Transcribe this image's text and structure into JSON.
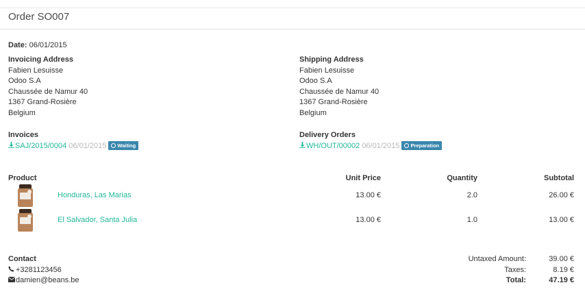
{
  "order": {
    "title": "Order SO007"
  },
  "date": {
    "label": "Date:",
    "value": "06/01/2015"
  },
  "invoicing": {
    "title": "Invoicing Address",
    "lines": [
      "Fabien Lesuisse",
      "Odoo S.A",
      "Chaussée de Namur 40",
      "1367 Grand-Rosière",
      "Belgium"
    ]
  },
  "shipping": {
    "title": "Shipping Address",
    "lines": [
      "Fabien Lesuisse",
      "Odoo S.A",
      "Chaussée de Namur 40",
      "1367 Grand-Rosière",
      "Belgium"
    ]
  },
  "invoices": {
    "title": "Invoices",
    "ref": "SAJ/2015/0004",
    "date": "06/01/2015",
    "status": "Waiting",
    "icon": "download-icon",
    "status_color": "#3a87ad"
  },
  "deliveries": {
    "title": "Delivery Orders",
    "ref": "WH/OUT/00002",
    "date": "06/01/2015",
    "status": "Preparation",
    "icon": "download-icon",
    "status_color": "#3a87ad"
  },
  "lines_header": {
    "product": "Product",
    "unit_price": "Unit Price",
    "quantity": "Quantity",
    "subtotal": "Subtotal"
  },
  "lines": [
    {
      "name": "Honduras, Las Marias",
      "unit_price": "13.00 €",
      "quantity": "2.0",
      "subtotal": "26.00 €"
    },
    {
      "name": "El Salvador, Santa Julia",
      "unit_price": "13.00 €",
      "quantity": "1.0",
      "subtotal": "13.00 €"
    }
  ],
  "contact": {
    "title": "Contact",
    "phone": "+3281123456",
    "email": "damien@beans.be",
    "phone_icon": "phone-icon",
    "email_icon": "envelope-icon"
  },
  "totals": {
    "untaxed_label": "Untaxed Amount:",
    "untaxed_value": "39.00 €",
    "taxes_label": "Taxes:",
    "taxes_value": "8.19 €",
    "total_label": "Total:",
    "total_value": "47.19 €"
  },
  "colors": {
    "link": "#21b799",
    "badge": "#3a87ad"
  }
}
